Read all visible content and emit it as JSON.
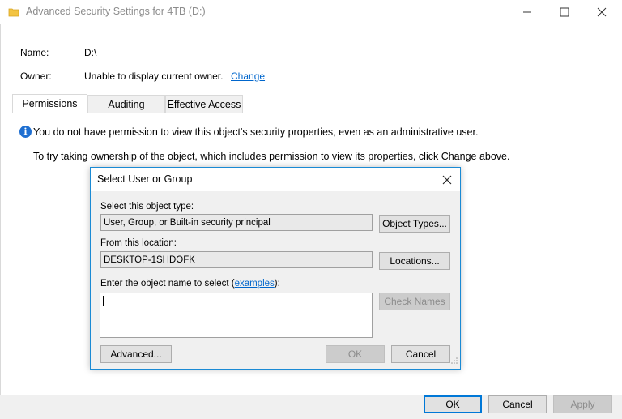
{
  "window": {
    "title": "Advanced Security Settings for 4TB (D:)",
    "controls": {
      "minimize": "minimize",
      "maximize": "maximize",
      "close": "close"
    }
  },
  "fields": {
    "name_label": "Name:",
    "name_value": "D:\\",
    "owner_label": "Owner:",
    "owner_value": "Unable to display current owner.",
    "owner_change_link": "Change"
  },
  "tabs": [
    {
      "label": "Permissions",
      "active": true
    },
    {
      "label": "Auditing",
      "active": false
    },
    {
      "label": "Effective Access",
      "active": false
    }
  ],
  "messages": {
    "no_permission": "You do not have permission to view this object's security properties, even as an administrative user.",
    "take_ownership": "To try taking ownership of the object, which includes permission to view its properties, click Change above."
  },
  "footer": {
    "ok": "OK",
    "cancel": "Cancel",
    "apply": "Apply"
  },
  "dialog": {
    "title": "Select User or Group",
    "object_type_label": "Select this object type:",
    "object_type_value": "User, Group, or Built-in security principal",
    "object_types_button": "Object Types...",
    "location_label": "From this location:",
    "location_value": "DESKTOP-1SHDOFK",
    "locations_button": "Locations...",
    "enter_label_prefix": "Enter the object name to select (",
    "examples_link": "examples",
    "enter_label_suffix": "):",
    "object_name_value": "",
    "check_names_button": "Check Names",
    "advanced_button": "Advanced...",
    "ok_button": "OK",
    "cancel_button": "Cancel"
  },
  "colors": {
    "accent": "#0078d7",
    "link": "#0066cc",
    "info_icon": "#1f6fd1"
  }
}
